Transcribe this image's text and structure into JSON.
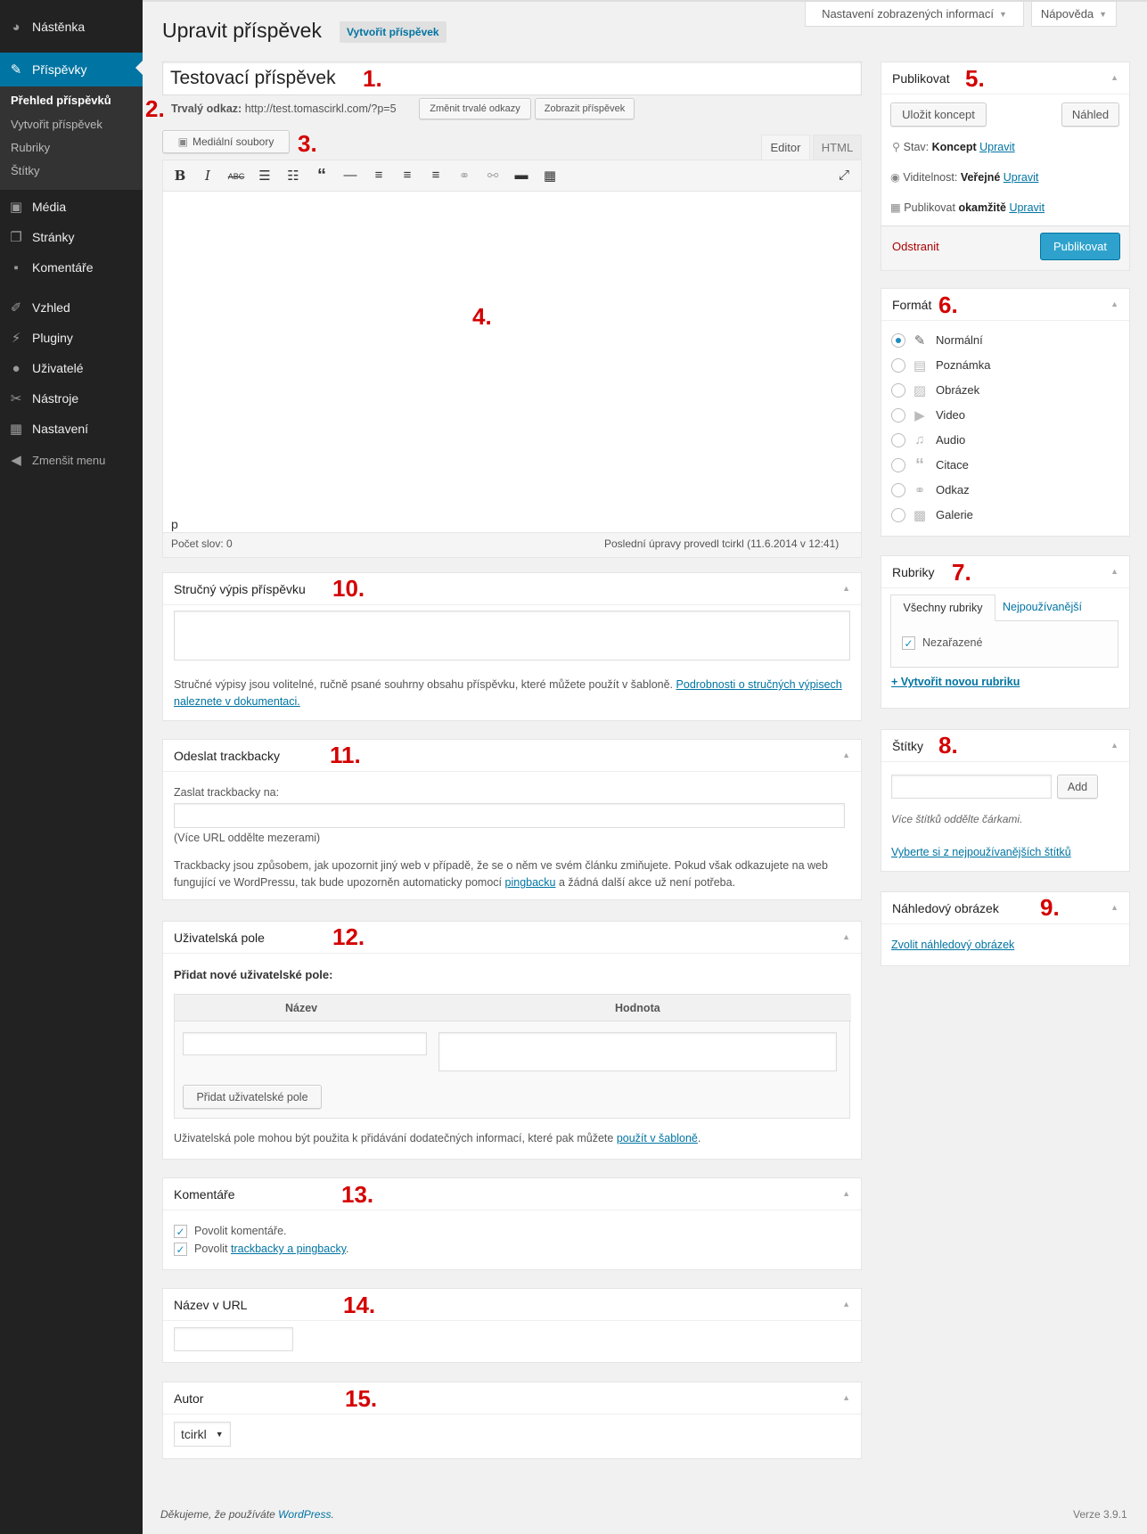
{
  "sidebar": {
    "items": [
      {
        "label": "Nástěnka",
        "icon": "dashboard-icon"
      },
      {
        "label": "Příspěvky",
        "icon": "pin-icon"
      },
      {
        "label": "Média",
        "icon": "media-icon"
      },
      {
        "label": "Stránky",
        "icon": "pages-icon"
      },
      {
        "label": "Komentáře",
        "icon": "comments-icon"
      },
      {
        "label": "Vzhled",
        "icon": "appearance-icon"
      },
      {
        "label": "Pluginy",
        "icon": "plugins-icon"
      },
      {
        "label": "Uživatelé",
        "icon": "users-icon"
      },
      {
        "label": "Nástroje",
        "icon": "tools-icon"
      },
      {
        "label": "Nastavení",
        "icon": "settings-icon"
      }
    ],
    "submenu": [
      "Přehled příspěvků",
      "Vytvořit příspěvek",
      "Rubriky",
      "Štítky"
    ],
    "collapse": "Zmenšit menu"
  },
  "screen_options": "Nastavení zobrazených informací",
  "help": "Nápověda",
  "page_title": "Upravit příspěvek",
  "add_new": "Vytvořit příspěvek",
  "post_title": "Testovací příspěvek",
  "permalink": {
    "label": "Trvalý odkaz:",
    "url": "http://test.tomascirkl.com/?p=5",
    "change": "Změnit trvalé odkazy",
    "view": "Zobrazit příspěvek"
  },
  "media_button": "Mediální soubory",
  "editor_tabs": {
    "visual": "Editor",
    "html": "HTML"
  },
  "editor": {
    "path": "p",
    "word_count": "Počet slov: 0",
    "last_edit": "Poslední úpravy provedl tcirkl (11.6.2014 v 12:41)"
  },
  "annotations": [
    "1.",
    "2.",
    "3.",
    "4.",
    "5.",
    "6.",
    "7.",
    "8.",
    "9.",
    "10.",
    "11.",
    "12.",
    "13.",
    "14.",
    "15."
  ],
  "excerpt": {
    "title": "Stručný výpis příspěvku",
    "desc": "Stručné výpisy jsou volitelné, ručně psané souhrny obsahu příspěvku, které můžete použít v šabloně.",
    "link": "Podrobnosti o stručných výpisech naleznete v dokumentaci."
  },
  "trackbacks": {
    "title": "Odeslat trackbacky",
    "label": "Zaslat trackbacky na:",
    "hint": "(Více URL oddělte mezerami)",
    "desc1": "Trackbacky jsou způsobem, jak upozornit jiný web v případě, že se o něm ve svém článku zmiňujete. Pokud však odkazujete na web fungující ve WordPressu, tak bude upozorněn automaticky pomocí",
    "link": "pingbacku",
    "desc2": "a žádná další akce už není potřeba."
  },
  "custom_fields": {
    "title": "Uživatelská pole",
    "add_label": "Přidat nové uživatelské pole:",
    "col_name": "Název",
    "col_value": "Hodnota",
    "add_button": "Přidat uživatelské pole",
    "desc": "Uživatelská pole mohou být použita k přidávání dodatečných informací, které pak můžete",
    "link": "použít v šabloně",
    "end": "."
  },
  "comments": {
    "title": "Komentáře",
    "allow_comments": "Povolit komentáře.",
    "allow_tb_pre": "Povolit",
    "allow_tb_link": "trackbacky a pingbacky",
    "allow_tb_post": "."
  },
  "slug": {
    "title": "Název v URL"
  },
  "author": {
    "title": "Autor",
    "value": "tcirkl"
  },
  "publish": {
    "title": "Publikovat",
    "save_draft": "Uložit koncept",
    "preview": "Náhled",
    "status_label": "Stav:",
    "status_value": "Koncept",
    "visibility_label": "Viditelnost:",
    "visibility_value": "Veřejné",
    "publish_label": "Publikovat",
    "publish_value": "okamžitě",
    "edit": "Upravit",
    "delete": "Odstranit",
    "publish_button": "Publikovat"
  },
  "format": {
    "title": "Formát",
    "options": [
      {
        "label": "Normální",
        "icon": "pin-icon",
        "checked": true
      },
      {
        "label": "Poznámka",
        "icon": "aside-icon"
      },
      {
        "label": "Obrázek",
        "icon": "image-icon"
      },
      {
        "label": "Video",
        "icon": "video-icon"
      },
      {
        "label": "Audio",
        "icon": "audio-icon"
      },
      {
        "label": "Citace",
        "icon": "quote-icon"
      },
      {
        "label": "Odkaz",
        "icon": "link-icon"
      },
      {
        "label": "Galerie",
        "icon": "gallery-icon"
      }
    ]
  },
  "categories": {
    "title": "Rubriky",
    "tab_all": "Všechny rubriky",
    "tab_popular": "Nejpoužívanější",
    "items": [
      {
        "label": "Nezařazené",
        "checked": true
      }
    ],
    "add": "+ Vytvořit novou rubriku"
  },
  "tags": {
    "title": "Štítky",
    "add": "Add",
    "hint": "Více štítků oddělte čárkami.",
    "choose": "Vyberte si z nejpoužívanějších štítků"
  },
  "thumbnail": {
    "title": "Náhledový obrázek",
    "link": "Zvolit náhledový obrázek"
  },
  "footer": {
    "thanks_pre": "Děkujeme, že používáte",
    "wp": "WordPress",
    "thanks_post": ".",
    "version": "Verze 3.9.1"
  },
  "colors": {
    "sidebar_bg": "#222222",
    "active": "#0074a2",
    "publish_button": "#2ea2cc",
    "delete": "#a00000",
    "annotation": "#d40000"
  }
}
